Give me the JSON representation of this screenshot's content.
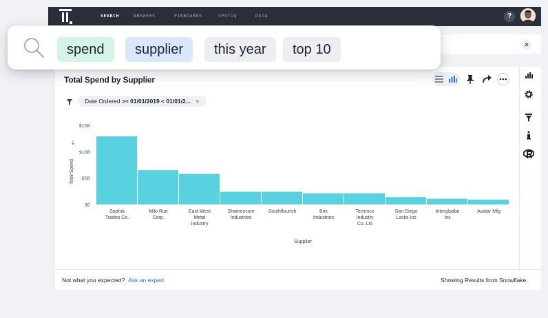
{
  "nav": {
    "items": [
      "SEARCH",
      "ANSWERS",
      "PINBOARDS",
      "SPOTIQ",
      "DATA"
    ],
    "help": "?"
  },
  "search": {
    "tokens": [
      "spend",
      "supplier",
      "this year",
      "top 10"
    ],
    "clear": "×"
  },
  "card": {
    "title": "Total Spend by Supplier"
  },
  "filter": {
    "label": "Date Ordered",
    "value": ">= 01/01/2019 < 01/01/2..."
  },
  "footer": {
    "prompt": "Not what you expected?",
    "link": "Ask an expert",
    "source": "Showing Results from Snowflake."
  },
  "colors": {
    "bar": "#58d1e1",
    "accent": "#2c6fe0",
    "nav_bg": "#2b2f39"
  },
  "side_icons": [
    "bar-chart-icon",
    "gear-icon",
    "filter-icon",
    "info-icon",
    "r-logo-icon"
  ],
  "chart_data": {
    "type": "bar",
    "title": "Total Spend by Supplier",
    "xlabel": "Supplier",
    "ylabel": "Total Spend",
    "ylim": [
      0,
      15
    ],
    "yticks": [
      "$0",
      "$5B",
      "$10B",
      "$15B"
    ],
    "categories": [
      [
        "Sophia",
        "Trades Co."
      ],
      [
        "Milo Run",
        "Corp."
      ],
      [
        "East-West",
        "Metal",
        "Industry"
      ],
      [
        "Shamezcom",
        "Industries"
      ],
      [
        "Southflourish"
      ],
      [
        "Brix",
        "Industries"
      ],
      [
        "Terrence",
        "Industry",
        "Co. Lts"
      ],
      [
        "San Diego",
        "Locks Inc"
      ],
      [
        "Intergloabe",
        "Inc"
      ],
      [
        "Avatar Mfg"
      ]
    ],
    "values": [
      12.9,
      6.5,
      5.8,
      2.4,
      2.4,
      2.1,
      2.1,
      1.4,
      1.1,
      0.9
    ],
    "unit": "B",
    "grid": false,
    "legend": "none"
  }
}
